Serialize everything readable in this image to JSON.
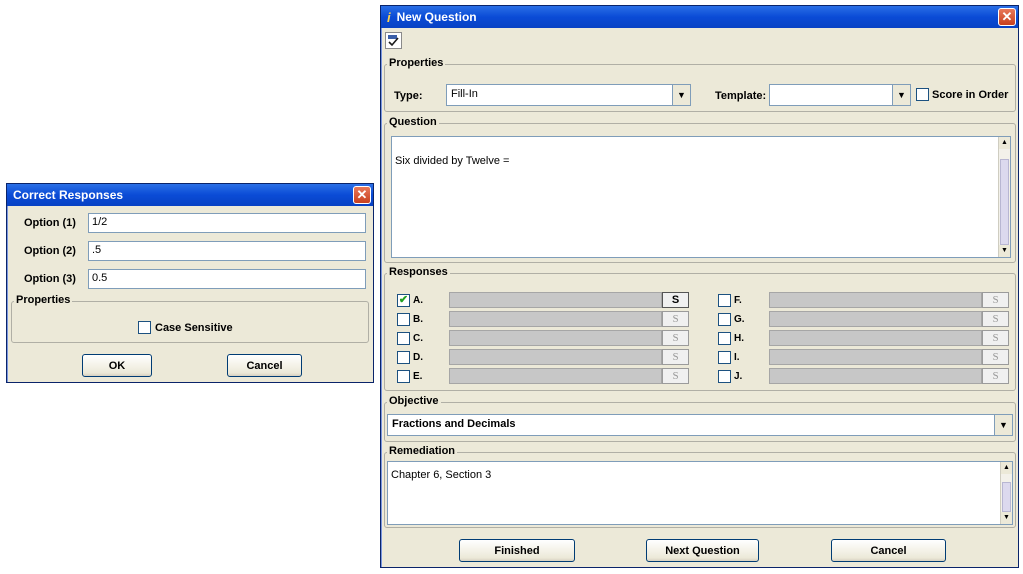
{
  "correct_responses": {
    "title": "Correct Responses",
    "options": [
      {
        "label": "Option (1)",
        "value": "1/2"
      },
      {
        "label": "Option (2)",
        "value": ".5"
      },
      {
        "label": "Option (3)",
        "value": "0.5"
      }
    ],
    "properties_label": "Properties",
    "case_sensitive_label": "Case Sensitive",
    "case_sensitive_checked": false,
    "ok_label": "OK",
    "cancel_label": "Cancel"
  },
  "new_question": {
    "title": "New Question",
    "properties_label": "Properties",
    "type_label": "Type:",
    "type_value": "Fill-In",
    "template_label": "Template:",
    "template_value": "",
    "score_in_order_label": "Score in Order",
    "question_label": "Question",
    "question_text": "Six divided by Twelve =",
    "responses_label": "Responses",
    "responses_left": [
      {
        "letter": "A.",
        "checked": true,
        "s_active": true
      },
      {
        "letter": "B.",
        "checked": false,
        "s_active": false
      },
      {
        "letter": "C.",
        "checked": false,
        "s_active": false
      },
      {
        "letter": "D.",
        "checked": false,
        "s_active": false
      },
      {
        "letter": "E.",
        "checked": false,
        "s_active": false
      }
    ],
    "responses_right": [
      {
        "letter": "F.",
        "checked": false,
        "s_active": false
      },
      {
        "letter": "G.",
        "checked": false,
        "s_active": false
      },
      {
        "letter": "H.",
        "checked": false,
        "s_active": false
      },
      {
        "letter": "I.",
        "checked": false,
        "s_active": false
      },
      {
        "letter": "J.",
        "checked": false,
        "s_active": false
      }
    ],
    "s_label": "S",
    "objective_label": "Objective",
    "objective_value": "Fractions and Decimals",
    "remediation_label": "Remediation",
    "remediation_text": "Chapter 6, Section 3",
    "finished_label": "Finished",
    "next_question_label": "Next Question",
    "cancel_label": "Cancel"
  },
  "icons": {
    "title_icon": "i",
    "close_icon": "✕",
    "toolbar_icon": "spellcheck-icon",
    "dropdown_arrow": "▼",
    "scroll_up": "▲",
    "scroll_down": "▼",
    "check_mark": "✔"
  },
  "colors": {
    "titlebar": "#0a4bd6",
    "window_bg": "#ece9d8",
    "close_button": "#c8401e"
  }
}
